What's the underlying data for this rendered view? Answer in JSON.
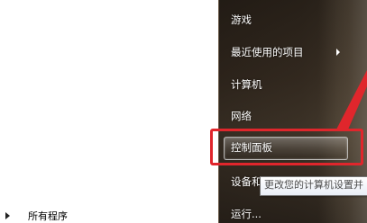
{
  "start_menu": {
    "left_pane": {
      "all_programs": "所有程序"
    },
    "right_pane": {
      "items": [
        {
          "label": "游戏"
        },
        {
          "label": "最近使用的项目"
        },
        {
          "label": "计算机"
        },
        {
          "label": "网络"
        },
        {
          "label": "控制面板"
        },
        {
          "label": "设备和"
        },
        {
          "label": "运行..."
        }
      ]
    },
    "tooltip": "更改您的计算机设置并"
  },
  "colors": {
    "annotation": "#e0262c"
  }
}
